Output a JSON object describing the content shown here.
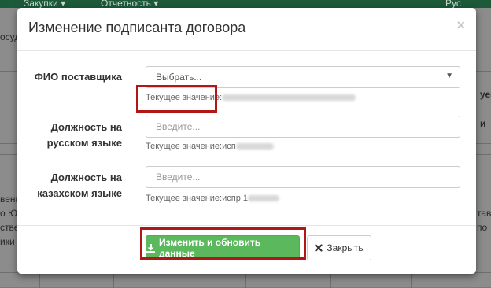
{
  "background": {
    "nav": [
      "Закупки ▾",
      "Отчетность ▾",
      "Рус"
    ],
    "fragments": [
      "осуд",
      "уем",
      "и",
      "вени",
      "о Ю",
      "ствен",
      "ики",
      "тав",
      "по"
    ]
  },
  "modal": {
    "title": "Изменение подписанта договора",
    "close_symbol": "×",
    "fields": [
      {
        "label_line1": "ФИО поставщика",
        "label_line2": "",
        "value": "Выбрать...",
        "help_prefix": "Текущее значение:",
        "help_visible": ""
      },
      {
        "label_line1": "Должность на",
        "label_line2": "русском языке",
        "placeholder": "Введите...",
        "help_prefix": "Текущее значение:",
        "help_visible": "исп"
      },
      {
        "label_line1": "Должность на",
        "label_line2": "казахском языке",
        "placeholder": "Введите...",
        "help_prefix": "Текущее значение:",
        "help_visible": "испр 1"
      }
    ],
    "buttons": {
      "save_label": "Изменить и обновить данные",
      "close_label": "Закрыть"
    }
  },
  "colors": {
    "primary": "#5cb85c",
    "highlight": "#b01818",
    "nav": "#1d5a3a"
  },
  "icons": {
    "save": "download-icon",
    "close_button": "times-icon",
    "dropdown": "caret-down-icon"
  }
}
